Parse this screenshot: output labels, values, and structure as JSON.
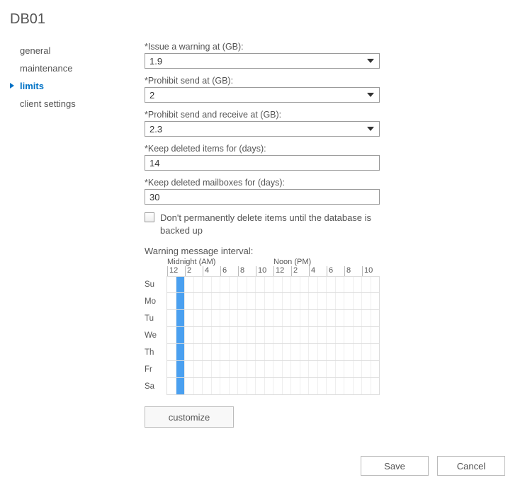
{
  "title": "DB01",
  "sidebar": {
    "items": [
      {
        "label": "general",
        "active": false
      },
      {
        "label": "maintenance",
        "active": false
      },
      {
        "label": "limits",
        "active": true
      },
      {
        "label": "client settings",
        "active": false
      }
    ]
  },
  "fields": {
    "warning_label": "*Issue a warning at (GB):",
    "warning_value": "1.9",
    "prohibit_send_label": "*Prohibit send at (GB):",
    "prohibit_send_value": "2",
    "prohibit_sr_label": "*Prohibit send and receive at (GB):",
    "prohibit_sr_value": "2.3",
    "keep_items_label": "*Keep deleted items for (days):",
    "keep_items_value": "14",
    "keep_mailboxes_label": "*Keep deleted mailboxes for (days):",
    "keep_mailboxes_value": "30"
  },
  "checkbox": {
    "checked": false,
    "label": "Don't permanently delete items until the database is backed up"
  },
  "schedule": {
    "label": "Warning message interval:",
    "header_left": "Midnight (AM)",
    "header_right": "Noon (PM)",
    "hours": [
      "12",
      "2",
      "4",
      "6",
      "8",
      "10",
      "12",
      "2",
      "4",
      "6",
      "8",
      "10"
    ],
    "days": [
      "Su",
      "Mo",
      "Tu",
      "We",
      "Th",
      "Fr",
      "Sa"
    ],
    "selected_slot": 1
  },
  "buttons": {
    "customize": "customize",
    "save": "Save",
    "cancel": "Cancel"
  }
}
